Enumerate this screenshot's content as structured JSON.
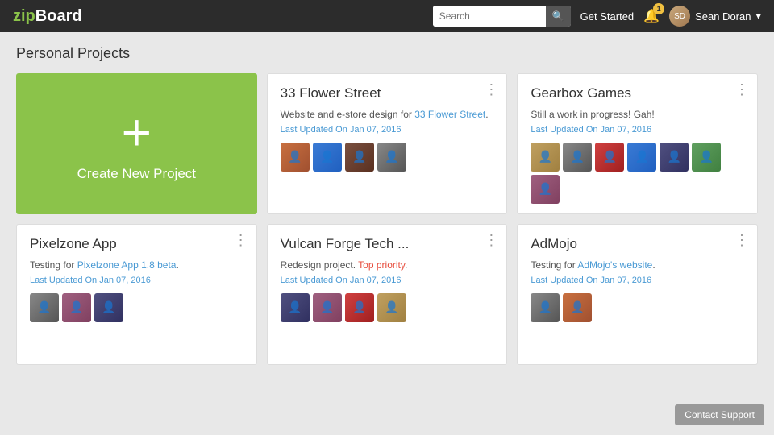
{
  "header": {
    "logo_zip": "zip",
    "logo_board": "Board",
    "search_placeholder": "Search",
    "get_started_label": "Get Started",
    "notification_count": "1",
    "user_name": "Sean Doran",
    "dropdown_arrow": "▾"
  },
  "page": {
    "title": "Personal Projects"
  },
  "create_card": {
    "plus_symbol": "+",
    "label": "Create New Project"
  },
  "projects": [
    {
      "id": "33-flower-street",
      "title": "33 Flower Street",
      "desc_before": "Website and e-store design for ",
      "desc_link": "33 Flower Street",
      "desc_after": ".",
      "updated": "Last Updated On Jan 07, 2016",
      "avatars": [
        "av1",
        "av2",
        "av3",
        "av4"
      ]
    },
    {
      "id": "gearbox-games",
      "title": "Gearbox Games",
      "desc_before": "Still a work in progress! Gah!",
      "desc_link": "",
      "desc_after": "",
      "updated": "Last Updated On Jan 07, 2016",
      "avatars": [
        "av5",
        "av4",
        "av6",
        "av2",
        "av7",
        "av8"
      ]
    },
    {
      "id": "pixelzone-app",
      "title": "Pixelzone App",
      "desc_before": "Testing for ",
      "desc_link": "Pixelzone App 1.8 beta",
      "desc_after": ".",
      "updated": "Last Updated On Jan 07, 2016",
      "avatars": [
        "av4",
        "av9",
        "av7"
      ]
    },
    {
      "id": "vulcan-forge-tech",
      "title": "Vulcan Forge Tech ...",
      "desc_before": "Redesign project. ",
      "desc_link": "Top priority",
      "desc_after": ".",
      "updated": "Last Updated On Jan 07, 2016",
      "avatars": [
        "av7",
        "av9",
        "av6",
        "av5"
      ]
    },
    {
      "id": "admojo",
      "title": "AdMojo",
      "desc_before": "Testing for ",
      "desc_link": "AdMojo's website",
      "desc_after": ".",
      "updated": "Last Updated On Jan 07, 2016",
      "avatars": [
        "av4",
        "av1"
      ]
    }
  ],
  "contact_support_label": "Contact Support"
}
